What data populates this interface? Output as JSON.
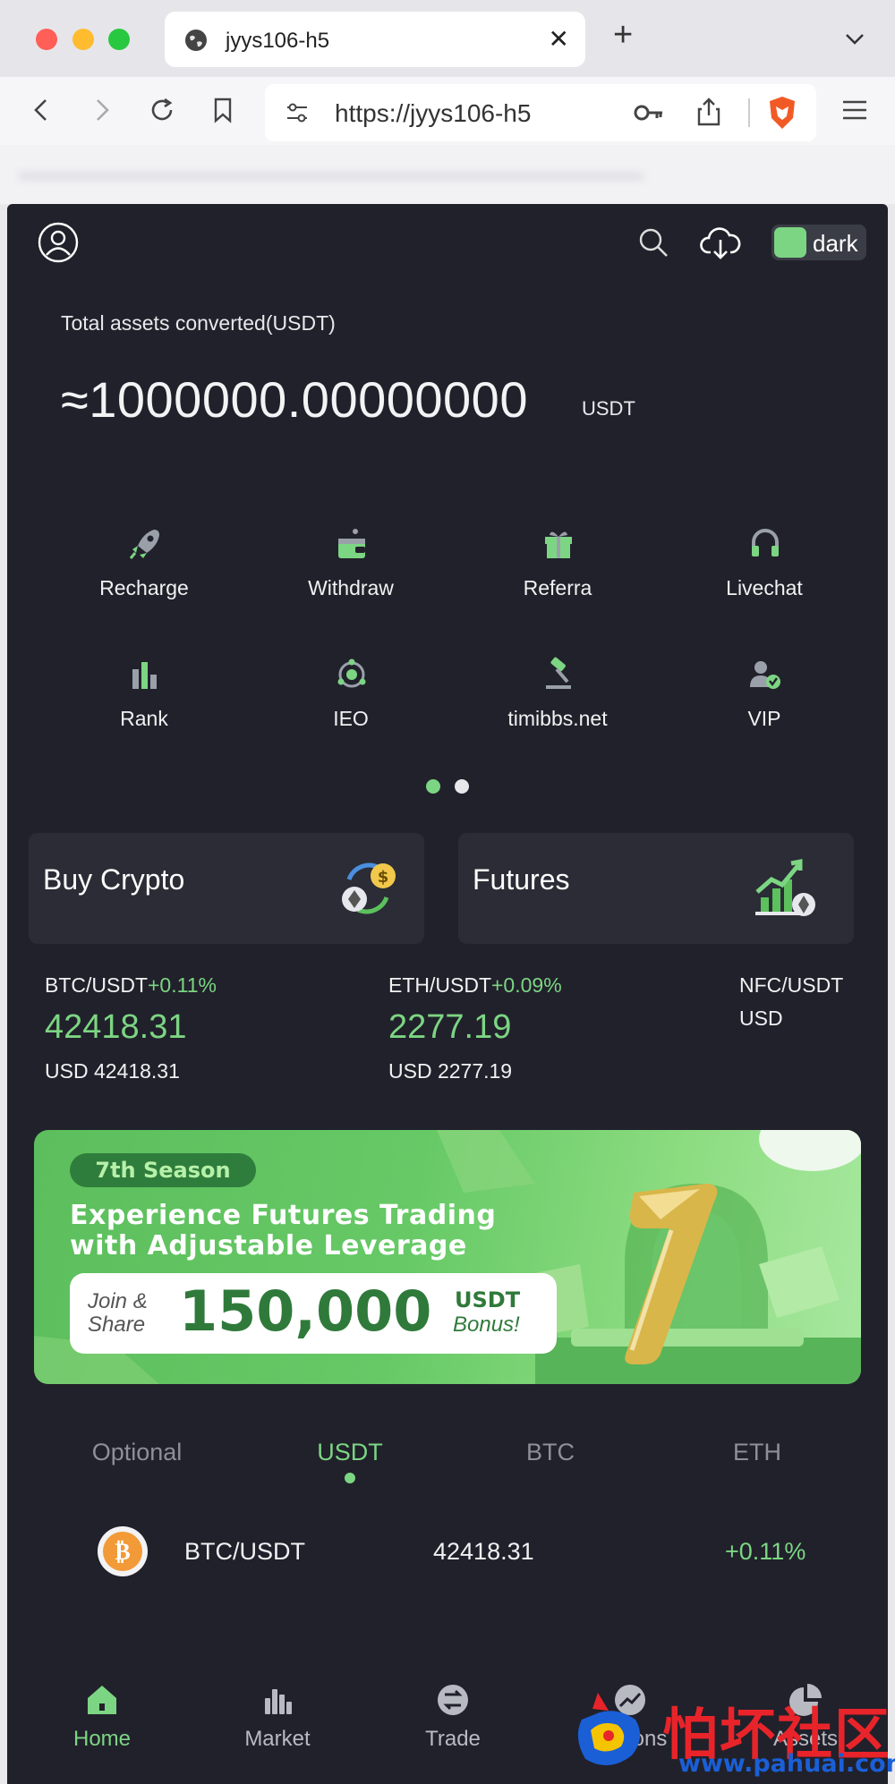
{
  "browser": {
    "tab_title": "jyys106-h5",
    "url": "https://jyys106-h5",
    "new_tab_label": "+"
  },
  "header": {
    "theme_label": "dark"
  },
  "assets": {
    "label": "Total assets converted(USDT)",
    "value": "≈1000000.00000000",
    "unit": "USDT"
  },
  "quick_actions": [
    {
      "label": "Recharge",
      "icon": "rocket-icon"
    },
    {
      "label": "Withdraw",
      "icon": "wallet-icon"
    },
    {
      "label": "Referra",
      "icon": "gift-icon"
    },
    {
      "label": "Livechat",
      "icon": "headset-icon"
    },
    {
      "label": "Rank",
      "icon": "bar-chart-icon"
    },
    {
      "label": "IEO",
      "icon": "network-icon"
    },
    {
      "label": "timibbs.net",
      "icon": "hammer-icon"
    },
    {
      "label": "VIP",
      "icon": "vip-user-icon"
    }
  ],
  "cards": {
    "buy_crypto": "Buy Crypto",
    "futures": "Futures"
  },
  "tickers": [
    {
      "pair": "BTC/USDT",
      "change": "+0.11%",
      "price": "42418.31",
      "usd": "USD 42418.31"
    },
    {
      "pair": "ETH/USDT",
      "change": "+0.09%",
      "price": "2277.19",
      "usd": "USD 2277.19"
    },
    {
      "pair": "NFC/USDT",
      "change": "",
      "price": "",
      "usd": "USD"
    }
  ],
  "banner": {
    "season": "7th Season",
    "line1": "Experience Futures Trading",
    "line2": "with Adjustable Leverage",
    "join1": "Join &",
    "join2": "Share",
    "amount": "150,000",
    "unit1": "USDT",
    "unit2": "Bonus!",
    "big_number": "7"
  },
  "market_tabs": [
    {
      "label": "Optional",
      "active": false
    },
    {
      "label": "USDT",
      "active": true
    },
    {
      "label": "BTC",
      "active": false
    },
    {
      "label": "ETH",
      "active": false
    }
  ],
  "market_rows": [
    {
      "pair": "BTC/USDT",
      "price": "42418.31",
      "change": "+0.11%"
    }
  ],
  "bottom_nav": [
    {
      "label": "Home",
      "active": true,
      "icon": "home-icon"
    },
    {
      "label": "Market",
      "active": false,
      "icon": "market-icon"
    },
    {
      "label": "Trade",
      "active": false,
      "icon": "trade-icon"
    },
    {
      "label": "Options",
      "active": false,
      "icon": "options-icon"
    },
    {
      "label": "Assets",
      "active": false,
      "icon": "pie-chart-icon"
    }
  ],
  "watermark": {
    "cn": "怕坏社区",
    "url": "www.pahuai.com"
  },
  "colors": {
    "app_bg": "#21212b",
    "accent_green": "#7cd583",
    "card_bg": "#2b2c36",
    "muted_text": "#8e8f98"
  }
}
